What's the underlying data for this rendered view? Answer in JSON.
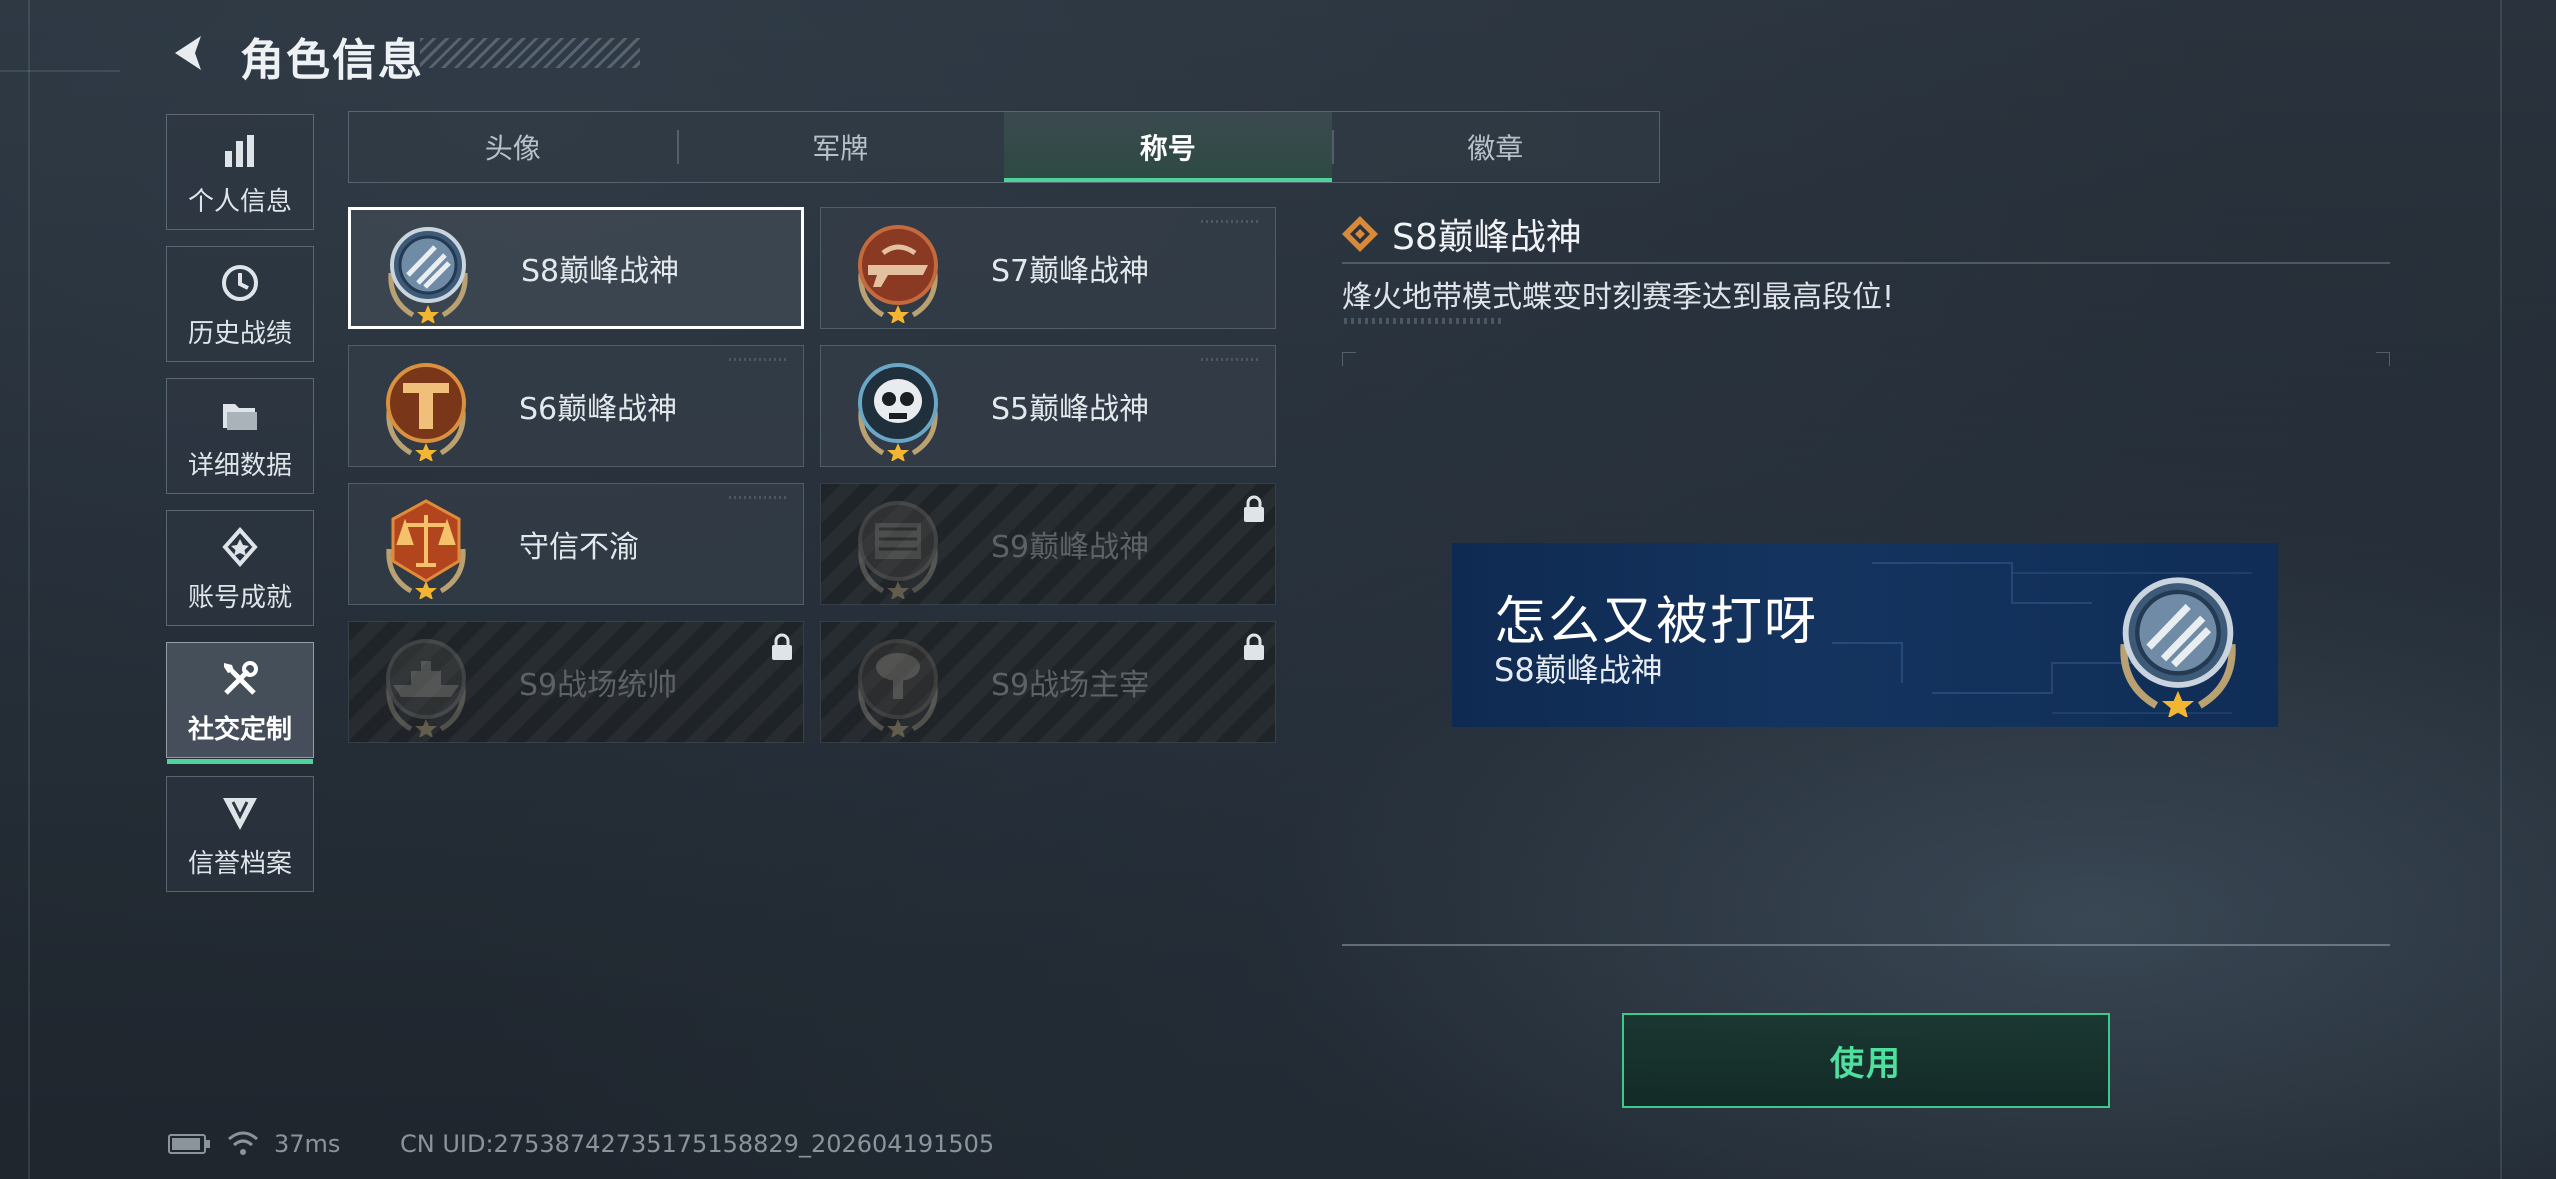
{
  "header": {
    "title": "角色信息"
  },
  "nav": [
    {
      "label": "个人信息",
      "icon": "bar-chart-icon",
      "active": false
    },
    {
      "label": "历史战绩",
      "icon": "clock-history-icon",
      "active": false
    },
    {
      "label": "详细数据",
      "icon": "folder-icon",
      "active": false
    },
    {
      "label": "账号成就",
      "icon": "achievement-icon",
      "active": false
    },
    {
      "label": "社交定制",
      "icon": "tools-icon",
      "active": true
    },
    {
      "label": "信誉档案",
      "icon": "credit-shield-icon",
      "active": false
    }
  ],
  "tabs": [
    {
      "label": "头像",
      "active": false
    },
    {
      "label": "军牌",
      "active": false
    },
    {
      "label": "称号",
      "active": true
    },
    {
      "label": "徽章",
      "active": false
    }
  ],
  "cards": [
    {
      "label": "S8巅峰战神",
      "badge": "s8-badge-icon",
      "selected": true,
      "locked": false
    },
    {
      "label": "S7巅峰战神",
      "badge": "s7-badge-icon",
      "selected": false,
      "locked": false
    },
    {
      "label": "S6巅峰战神",
      "badge": "s6-badge-icon",
      "selected": false,
      "locked": false
    },
    {
      "label": "S5巅峰战神",
      "badge": "s5-badge-icon",
      "selected": false,
      "locked": false
    },
    {
      "label": "守信不渝",
      "badge": "scales-badge-icon",
      "selected": false,
      "locked": false
    },
    {
      "label": "S9巅峰战神",
      "badge": "s9-badge-icon",
      "selected": false,
      "locked": true
    },
    {
      "label": "S9战场统帅",
      "badge": "warship-badge-icon",
      "selected": false,
      "locked": true
    },
    {
      "label": "S9战场主宰",
      "badge": "explosion-badge-icon",
      "selected": false,
      "locked": true
    }
  ],
  "detail": {
    "title": "S8巅峰战神",
    "description": "烽火地带模式蝶变时刻赛季达到最高段位!",
    "preview_name": "怎么又被打呀",
    "preview_title": "S8巅峰战神",
    "use_label": "使用"
  },
  "status": {
    "ping": "37ms",
    "uid": "CN UID:27538742735175158829_202604191505"
  },
  "colors": {
    "accent": "#4fd39a",
    "banner": "#14345f",
    "badge_bronze": "#c76a2c"
  }
}
